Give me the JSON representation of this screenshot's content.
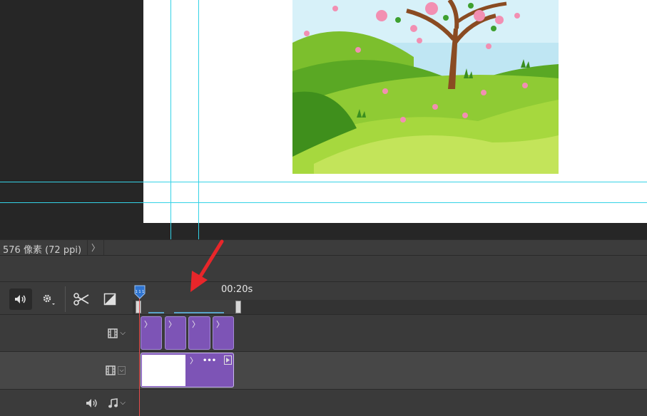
{
  "status_bar": {
    "doc_info": "576 像素 (72 ppi)",
    "arrow": "〉"
  },
  "timeline": {
    "time_label": "00:20s",
    "playhead_marker": "1 1 1"
  },
  "tracks": {
    "video_track_1": {
      "clip_count": 4
    },
    "video_track_2": {
      "clip_more": "•••"
    }
  },
  "colors": {
    "guide": "#34d2e6",
    "clip": "#7d54b6",
    "playhead": "#e64b4b",
    "annotation_arrow": "#e8262a"
  },
  "icons": [
    "speaker-icon",
    "gear-icon",
    "scissors-icon",
    "transition-icon",
    "film-icon",
    "chevron-down-icon",
    "music-note-icon",
    "arrow-annotation-icon"
  ]
}
